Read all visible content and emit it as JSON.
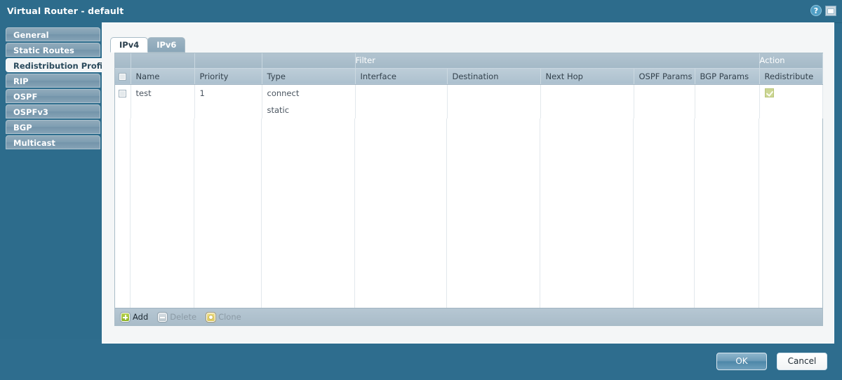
{
  "window": {
    "title": "Virtual Router - default",
    "help_icon_label": "?",
    "icons": [
      "help-icon",
      "window-icon"
    ]
  },
  "sidebar": {
    "items": [
      {
        "label": "General",
        "active": false
      },
      {
        "label": "Static Routes",
        "active": false
      },
      {
        "label": "Redistribution Profile",
        "active": true
      },
      {
        "label": "RIP",
        "active": false
      },
      {
        "label": "OSPF",
        "active": false
      },
      {
        "label": "OSPFv3",
        "active": false
      },
      {
        "label": "BGP",
        "active": false
      },
      {
        "label": "Multicast",
        "active": false
      }
    ]
  },
  "tabs": [
    {
      "label": "IPv4",
      "active": true
    },
    {
      "label": "IPv6",
      "active": false
    }
  ],
  "table": {
    "group_headers": [
      {
        "label": "",
        "span": 1
      },
      {
        "label": "",
        "span": 1
      },
      {
        "label": "",
        "span": 1
      },
      {
        "label": "",
        "span": 1
      },
      {
        "label": "Filter",
        "span": 4
      },
      {
        "label": "Action",
        "span": 1
      }
    ],
    "group_filter_label": "Filter",
    "group_action_label": "Action",
    "columns": [
      "Name",
      "Priority",
      "Type",
      "Interface",
      "Destination",
      "Next Hop",
      "OSPF Params",
      "BGP Params",
      "Redistribute"
    ],
    "rows": [
      {
        "selected": false,
        "name": "test",
        "priority": "1",
        "type_line1": "connect",
        "type_line2": "static",
        "interface": "",
        "destination": "",
        "next_hop": "",
        "ospf_params": "",
        "bgp_params": "",
        "redistribute": true
      }
    ]
  },
  "toolbar": {
    "add_label": "Add",
    "delete_label": "Delete",
    "clone_label": "Clone",
    "add_enabled": true,
    "delete_enabled": false,
    "clone_enabled": false
  },
  "footer": {
    "ok_label": "OK",
    "cancel_label": "Cancel"
  },
  "colors": {
    "window_bg": "#2e6d8e",
    "titlebar": "#2d6c8c",
    "panel_bg": "#f4f6f7",
    "header_grad_top": "#bdcdd8",
    "header_grad_bottom": "#acc0ce",
    "accent_check": "#ccd693",
    "add_icon": "#8fb32b"
  }
}
